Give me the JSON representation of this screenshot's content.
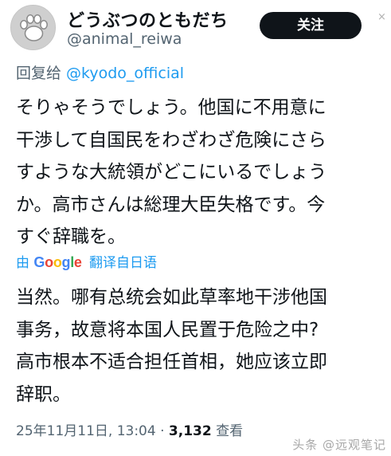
{
  "header": {
    "display_name": "どうぶつのともだち",
    "handle": "@animal_reiwa",
    "follow_label": "关注",
    "close_glyph": "×",
    "avatar_icon": "cat-paw-icon"
  },
  "reply": {
    "prefix": "回复给 ",
    "mention": "@kyodo_official"
  },
  "tweet": {
    "lines": [
      "そりゃそうでしょう。他国に不用意に",
      "干渉して自国民をわざわざ危険にさら",
      "すような大統領がどこにいるでしょう",
      "か。高市さんは総理大臣失格です。今",
      "すぐ辞職を。"
    ]
  },
  "translation": {
    "by_label": "由",
    "google_letters": [
      {
        "ch": "G",
        "color": "#4285F4"
      },
      {
        "ch": "o",
        "color": "#EA4335"
      },
      {
        "ch": "o",
        "color": "#FBBC05"
      },
      {
        "ch": "g",
        "color": "#4285F4"
      },
      {
        "ch": "l",
        "color": "#34A853"
      },
      {
        "ch": "e",
        "color": "#EA4335"
      }
    ],
    "link_label": "翻译自日语",
    "lines": [
      "当然。哪有总统会如此草率地干涉他国",
      "事务，故意将本国人民置于危险之中?",
      "高市根本不适合担任首相，她应该立即",
      "辞职。"
    ]
  },
  "meta": {
    "timestamp": "25年11月11日, 13:04 · ",
    "views_count": "3,132",
    "views_label": " 查看"
  },
  "watermark": {
    "text": "头条 @远观笔记"
  },
  "colors": {
    "accent": "#1d9bf0",
    "text": "#0f1419",
    "muted": "#536471",
    "button_bg": "#0f1419"
  }
}
